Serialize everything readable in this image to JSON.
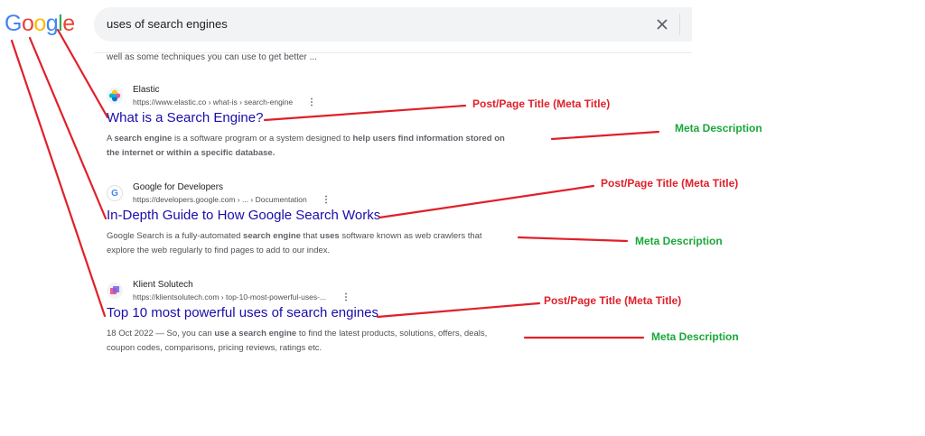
{
  "logo": {
    "letters": [
      "G",
      "o",
      "o",
      "g",
      "l",
      "e"
    ],
    "colors": [
      "#4285F4",
      "#EA4335",
      "#FBBC05",
      "#4285F4",
      "#34A853",
      "#EA4335"
    ]
  },
  "search": {
    "query": "uses of search engines"
  },
  "top_snippet": "well as some techniques you can use to get better ...",
  "results": [
    {
      "site_name": "Elastic",
      "url": "https://www.elastic.co › what-is › search-engine",
      "title": "What is a Search Engine?",
      "desc_line1_a": "A ",
      "desc_line1_b": "search engine",
      "desc_line1_c": " is a software program or a system designed to ",
      "desc_line1_d": "help users find information stored on",
      "desc_line2": "the internet or within a specific database."
    },
    {
      "site_name": "Google for Developers",
      "url": "https://developers.google.com › ... › Documentation",
      "title": "In-Depth Guide to How Google Search Works",
      "desc_line1_a": "Google Search is a fully-automated ",
      "desc_line1_b": "search engine",
      "desc_line1_c": " that ",
      "desc_line1_d": "uses",
      "desc_line1_e": " software known as web crawlers that",
      "desc_line2": "explore the web regularly to find pages to add to our index."
    },
    {
      "site_name": "Klient Solutech",
      "url": "https://klientsolutech.com › top-10-most-powerful-uses-...",
      "title": "Top 10 most powerful uses of search engines",
      "desc_line1_a": "18 Oct 2022 — So, you can ",
      "desc_line1_b": "use a search engine",
      "desc_line1_c": " to find the latest products, solutions, offers, deals,",
      "desc_line2": "coupon codes, comparisons, pricing reviews, ratings etc."
    }
  ],
  "annotations": {
    "title_label": "Post/Page  Title (Meta Title)",
    "desc_label": "Meta Description",
    "red": "#e0202a",
    "green": "#1aa83a"
  }
}
